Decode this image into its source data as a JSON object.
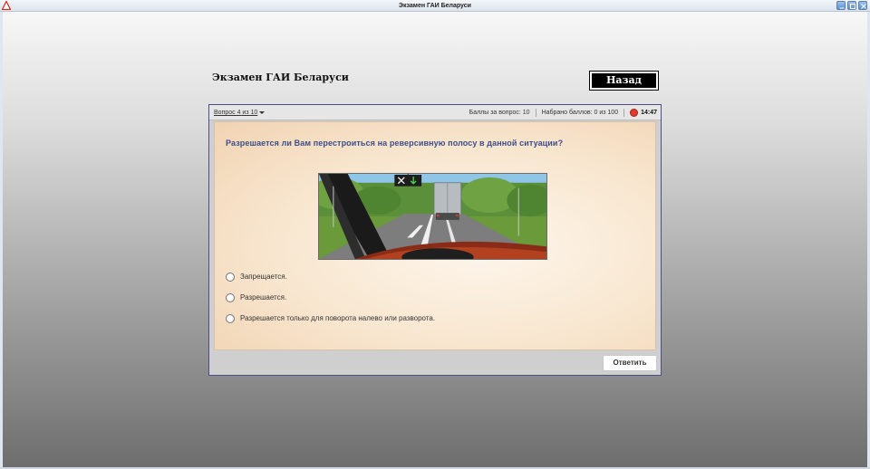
{
  "window": {
    "title": "Экзамен ГАИ Беларуси"
  },
  "page": {
    "title": "Экзамен ГАИ Беларуси",
    "back_label": "Назад"
  },
  "exam": {
    "question_selector": "Вопрос 4 из 10",
    "points_per_question": "Баллы за вопрос: 10",
    "points_scored": "Набрано баллов: 0 из 100",
    "timer": "14:47",
    "question": "Разрешается ли Вам перестроиться на реверсивную полосу в данной ситуации?",
    "answers": [
      "Запрещается.",
      "Разрешается.",
      "Разрешается только для поворота налево или разворота."
    ],
    "submit_label": "Ответить"
  },
  "colors": {
    "question_text": "#3c4e8a",
    "timer_icon": "#e23a2a",
    "back_button_bg": "#000000"
  }
}
